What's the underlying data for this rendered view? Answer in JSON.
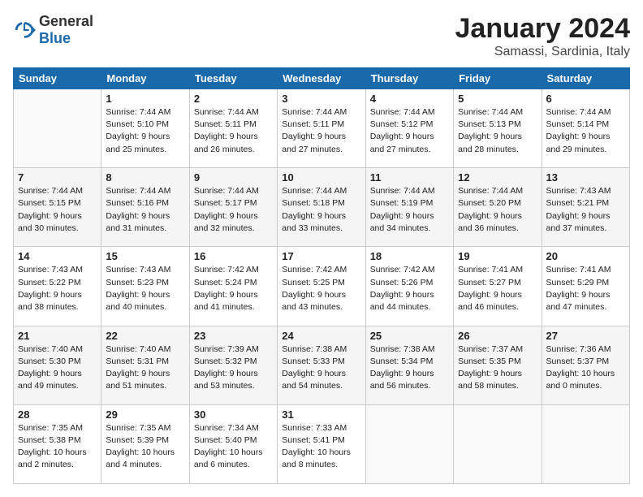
{
  "logo": {
    "general": "General",
    "blue": "Blue"
  },
  "title": "January 2024",
  "location": "Samassi, Sardinia, Italy",
  "days_of_week": [
    "Sunday",
    "Monday",
    "Tuesday",
    "Wednesday",
    "Thursday",
    "Friday",
    "Saturday"
  ],
  "weeks": [
    [
      {
        "day": "",
        "info": ""
      },
      {
        "day": "1",
        "info": "Sunrise: 7:44 AM\nSunset: 5:10 PM\nDaylight: 9 hours\nand 25 minutes."
      },
      {
        "day": "2",
        "info": "Sunrise: 7:44 AM\nSunset: 5:11 PM\nDaylight: 9 hours\nand 26 minutes."
      },
      {
        "day": "3",
        "info": "Sunrise: 7:44 AM\nSunset: 5:11 PM\nDaylight: 9 hours\nand 27 minutes."
      },
      {
        "day": "4",
        "info": "Sunrise: 7:44 AM\nSunset: 5:12 PM\nDaylight: 9 hours\nand 27 minutes."
      },
      {
        "day": "5",
        "info": "Sunrise: 7:44 AM\nSunset: 5:13 PM\nDaylight: 9 hours\nand 28 minutes."
      },
      {
        "day": "6",
        "info": "Sunrise: 7:44 AM\nSunset: 5:14 PM\nDaylight: 9 hours\nand 29 minutes."
      }
    ],
    [
      {
        "day": "7",
        "info": "Sunrise: 7:44 AM\nSunset: 5:15 PM\nDaylight: 9 hours\nand 30 minutes."
      },
      {
        "day": "8",
        "info": "Sunrise: 7:44 AM\nSunset: 5:16 PM\nDaylight: 9 hours\nand 31 minutes."
      },
      {
        "day": "9",
        "info": "Sunrise: 7:44 AM\nSunset: 5:17 PM\nDaylight: 9 hours\nand 32 minutes."
      },
      {
        "day": "10",
        "info": "Sunrise: 7:44 AM\nSunset: 5:18 PM\nDaylight: 9 hours\nand 33 minutes."
      },
      {
        "day": "11",
        "info": "Sunrise: 7:44 AM\nSunset: 5:19 PM\nDaylight: 9 hours\nand 34 minutes."
      },
      {
        "day": "12",
        "info": "Sunrise: 7:44 AM\nSunset: 5:20 PM\nDaylight: 9 hours\nand 36 minutes."
      },
      {
        "day": "13",
        "info": "Sunrise: 7:43 AM\nSunset: 5:21 PM\nDaylight: 9 hours\nand 37 minutes."
      }
    ],
    [
      {
        "day": "14",
        "info": "Sunrise: 7:43 AM\nSunset: 5:22 PM\nDaylight: 9 hours\nand 38 minutes."
      },
      {
        "day": "15",
        "info": "Sunrise: 7:43 AM\nSunset: 5:23 PM\nDaylight: 9 hours\nand 40 minutes."
      },
      {
        "day": "16",
        "info": "Sunrise: 7:42 AM\nSunset: 5:24 PM\nDaylight: 9 hours\nand 41 minutes."
      },
      {
        "day": "17",
        "info": "Sunrise: 7:42 AM\nSunset: 5:25 PM\nDaylight: 9 hours\nand 43 minutes."
      },
      {
        "day": "18",
        "info": "Sunrise: 7:42 AM\nSunset: 5:26 PM\nDaylight: 9 hours\nand 44 minutes."
      },
      {
        "day": "19",
        "info": "Sunrise: 7:41 AM\nSunset: 5:27 PM\nDaylight: 9 hours\nand 46 minutes."
      },
      {
        "day": "20",
        "info": "Sunrise: 7:41 AM\nSunset: 5:29 PM\nDaylight: 9 hours\nand 47 minutes."
      }
    ],
    [
      {
        "day": "21",
        "info": "Sunrise: 7:40 AM\nSunset: 5:30 PM\nDaylight: 9 hours\nand 49 minutes."
      },
      {
        "day": "22",
        "info": "Sunrise: 7:40 AM\nSunset: 5:31 PM\nDaylight: 9 hours\nand 51 minutes."
      },
      {
        "day": "23",
        "info": "Sunrise: 7:39 AM\nSunset: 5:32 PM\nDaylight: 9 hours\nand 53 minutes."
      },
      {
        "day": "24",
        "info": "Sunrise: 7:38 AM\nSunset: 5:33 PM\nDaylight: 9 hours\nand 54 minutes."
      },
      {
        "day": "25",
        "info": "Sunrise: 7:38 AM\nSunset: 5:34 PM\nDaylight: 9 hours\nand 56 minutes."
      },
      {
        "day": "26",
        "info": "Sunrise: 7:37 AM\nSunset: 5:35 PM\nDaylight: 9 hours\nand 58 minutes."
      },
      {
        "day": "27",
        "info": "Sunrise: 7:36 AM\nSunset: 5:37 PM\nDaylight: 10 hours\nand 0 minutes."
      }
    ],
    [
      {
        "day": "28",
        "info": "Sunrise: 7:35 AM\nSunset: 5:38 PM\nDaylight: 10 hours\nand 2 minutes."
      },
      {
        "day": "29",
        "info": "Sunrise: 7:35 AM\nSunset: 5:39 PM\nDaylight: 10 hours\nand 4 minutes."
      },
      {
        "day": "30",
        "info": "Sunrise: 7:34 AM\nSunset: 5:40 PM\nDaylight: 10 hours\nand 6 minutes."
      },
      {
        "day": "31",
        "info": "Sunrise: 7:33 AM\nSunset: 5:41 PM\nDaylight: 10 hours\nand 8 minutes."
      },
      {
        "day": "",
        "info": ""
      },
      {
        "day": "",
        "info": ""
      },
      {
        "day": "",
        "info": ""
      }
    ]
  ]
}
